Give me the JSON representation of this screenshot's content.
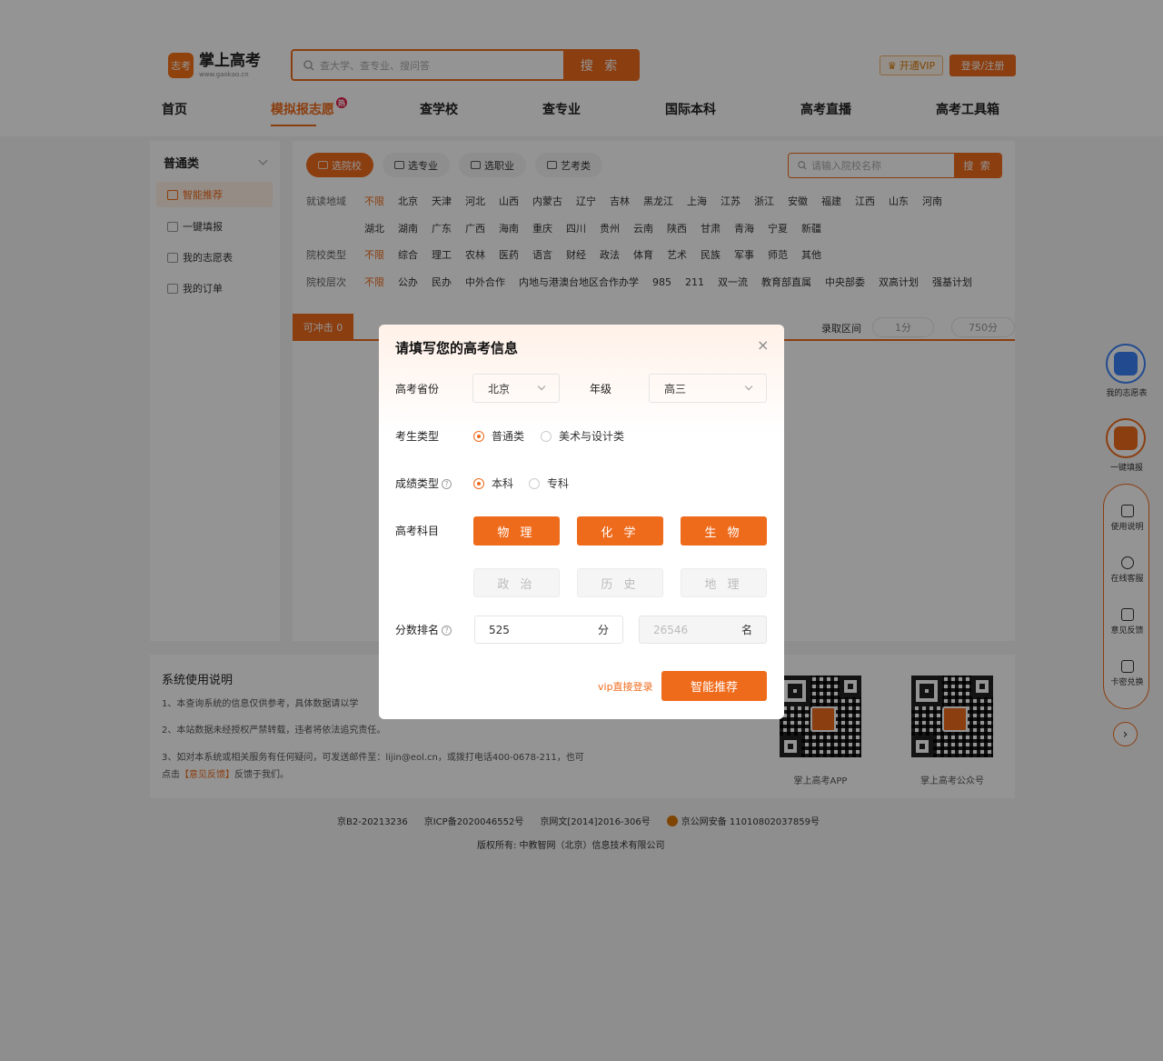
{
  "header": {
    "logo_badge": "志考",
    "logo_title": "掌上高考",
    "logo_url": "www.gaokao.cn",
    "search_placeholder": "查大学、查专业、搜问答",
    "search_button": "搜 索",
    "vip_button": "开通VIP",
    "login_button": "登录/注册"
  },
  "nav": {
    "items": [
      "首页",
      "模拟报志愿",
      "查学校",
      "查专业",
      "国际本科",
      "高考直播",
      "高考工具箱"
    ],
    "hot_badge": "热"
  },
  "sidebar": {
    "category": "普通类",
    "items": [
      "智能推荐",
      "一键填报",
      "我的志愿表",
      "我的订单"
    ]
  },
  "content": {
    "tabs": [
      "选院校",
      "选专业",
      "选职业",
      "艺考类"
    ],
    "school_search_placeholder": "请输入院校名称",
    "school_search_button": "搜 索",
    "filters": {
      "region_label": "就读地域",
      "region_row1": [
        "不限",
        "北京",
        "天津",
        "河北",
        "山西",
        "内蒙古",
        "辽宁",
        "吉林",
        "黑龙江",
        "上海",
        "江苏",
        "浙江",
        "安徽",
        "福建",
        "江西",
        "山东",
        "河南"
      ],
      "region_row2": [
        "湖北",
        "湖南",
        "广东",
        "广西",
        "海南",
        "重庆",
        "四川",
        "贵州",
        "云南",
        "陕西",
        "甘肃",
        "青海",
        "宁夏",
        "新疆"
      ],
      "type_label": "院校类型",
      "type_opts": [
        "不限",
        "综合",
        "理工",
        "农林",
        "医药",
        "语言",
        "财经",
        "政法",
        "体育",
        "艺术",
        "民族",
        "军事",
        "师范",
        "其他"
      ],
      "level_label": "院校层次",
      "level_opts": [
        "不限",
        "公办",
        "民办",
        "中外合作",
        "内地与港澳台地区合作办学",
        "985",
        "211",
        "双一流",
        "教育部直属",
        "中央部委",
        "双高计划",
        "强基计划"
      ]
    },
    "result_bar": {
      "kechong": "可冲击 0",
      "range_label": "录取区间",
      "range_min": "1分",
      "range_max": "750分"
    }
  },
  "system": {
    "title": "系统使用说明",
    "line1": "1、本查询系统的信息仅供参考，具体数据请以学",
    "line2": "2、本站数据未经授权严禁转载，违者将依法追究责任。",
    "line3": "3、如对本系统或相关服务有任何疑问，可发送邮件至：lijin@eol.cn，或拨打电话400-0678-211，也可",
    "line4_pre": "点击",
    "line4_link": "【意见反馈】",
    "line4_post": "反馈于我们。",
    "qr1_caption": "掌上高考APP",
    "qr2_caption": "掌上高考公众号"
  },
  "footer": {
    "icp1": "京B2-20213236",
    "icp2": "京ICP备2020046552号",
    "icp3": "京网文[2014]2016-306号",
    "police": "京公网安备 11010802037859号",
    "copyright": "版权所有: 中教智网（北京）信息技术有限公司"
  },
  "float_panel": {
    "my_plan": "我的志愿表",
    "one_click": "一键填报",
    "tools": [
      "使用说明",
      "在线客服",
      "意见反馈",
      "卡密兑换"
    ],
    "next": "›"
  },
  "modal": {
    "title": "请填写您的高考信息",
    "close": "×",
    "province_label": "高考省份",
    "province_value": "北京",
    "grade_label": "年级",
    "grade_value": "高三",
    "student_type_label": "考生类型",
    "student_type_opt1": "普通类",
    "student_type_opt2": "美术与设计类",
    "score_type_label": "成绩类型",
    "score_type_opt1": "本科",
    "score_type_opt2": "专科",
    "subjects_label": "高考科目",
    "subjects_selected": [
      "物 理",
      "化 学",
      "生 物"
    ],
    "subjects_unselected": [
      "政 治",
      "历 史",
      "地 理"
    ],
    "score_label": "分数排名",
    "score_value": "525",
    "score_unit": "分",
    "rank_value": "26546",
    "rank_unit": "名",
    "vip_link": "vip直接登录",
    "recommend_button": "智能推荐",
    "accent_color": "#ef6b1c"
  }
}
